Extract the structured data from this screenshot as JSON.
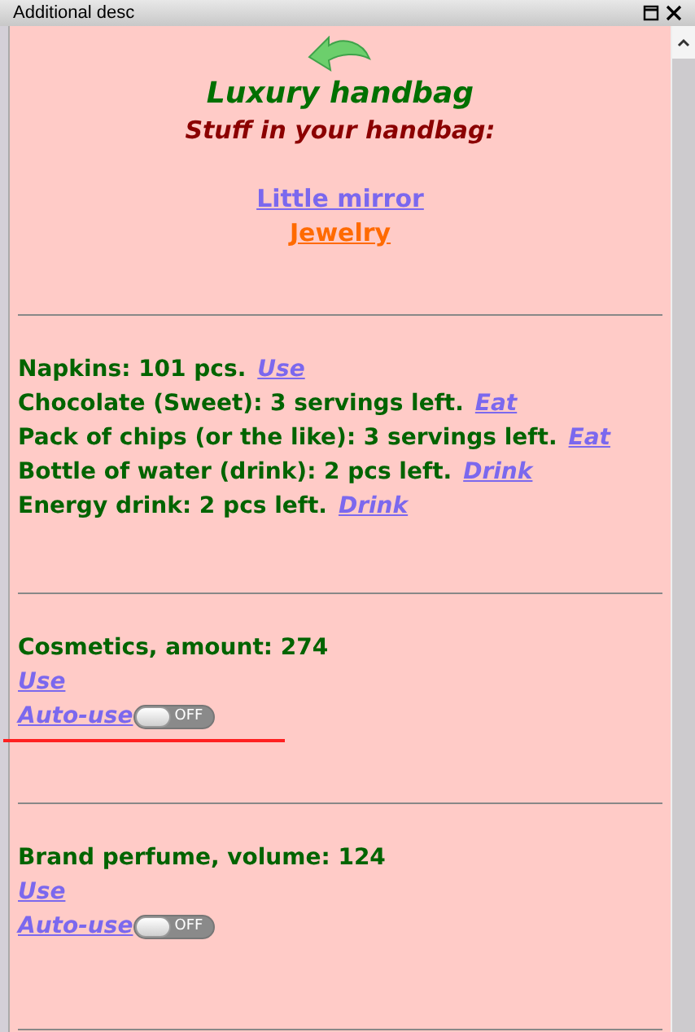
{
  "window": {
    "title": "Additional desc"
  },
  "header": {
    "title": "Luxury handbag",
    "subtitle": "Stuff in your handbag:"
  },
  "links": [
    {
      "label": "Little mirror",
      "color": "#7b68ee"
    },
    {
      "label": "Jewelry",
      "color": "#ff6a00"
    }
  ],
  "consumables": [
    {
      "text": "Napkins: 101 pcs.",
      "action": "Use"
    },
    {
      "text": "Chocolate (Sweet): 3 servings left.",
      "action": "Eat"
    },
    {
      "text": "Pack of chips (or the like): 3 servings left.",
      "action": "Eat"
    },
    {
      "text": "Bottle of water (drink): 2 pcs left.",
      "action": "Drink"
    },
    {
      "text": "Energy drink: 2 pcs left.",
      "action": "Drink"
    }
  ],
  "items": [
    {
      "text": "Cosmetics, amount: 274",
      "use": "Use",
      "auto_use": "Auto-use",
      "switch": {
        "on": false,
        "label": "OFF"
      }
    },
    {
      "text": "Brand perfume, volume: 124",
      "use": "Use",
      "auto_use": "Auto-use",
      "switch": {
        "on": false,
        "label": "OFF"
      }
    }
  ]
}
